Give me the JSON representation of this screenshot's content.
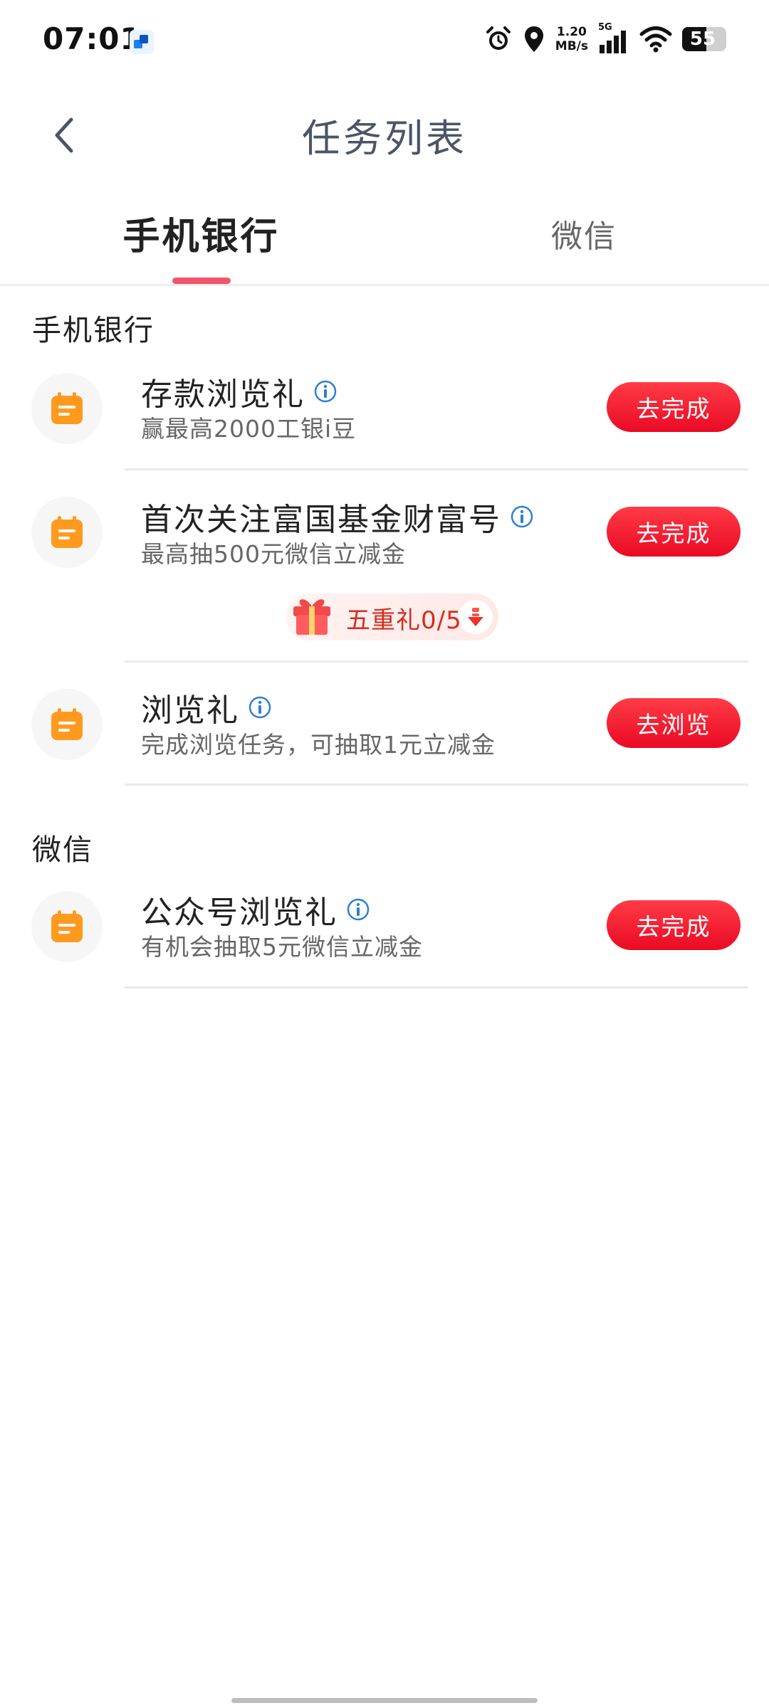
{
  "status_bar": {
    "time": "07:01",
    "net_speed_value": "1.20",
    "net_speed_unit": "MB/s",
    "network_type": "5G",
    "battery": "55",
    "battery_level": 0.55
  },
  "header": {
    "title": "任务列表"
  },
  "tabs": [
    {
      "label": "手机银行",
      "active": true
    },
    {
      "label": "微信",
      "active": false
    }
  ],
  "sections": {
    "mobile_bank": {
      "title": "手机银行",
      "tasks": [
        {
          "title": "存款浏览礼",
          "subtitle": "赢最高2000工银i豆",
          "button": "去完成",
          "icon": "calendar-icon"
        },
        {
          "title": "首次关注富国基金财富号",
          "subtitle": "最高抽500元微信立减金",
          "button": "去完成",
          "icon": "calendar-icon",
          "gift_label": "五重礼0/5"
        },
        {
          "title": "浏览礼",
          "subtitle": "完成浏览任务，可抽取1元立减金",
          "button": "去浏览",
          "icon": "calendar-icon"
        }
      ]
    },
    "wechat": {
      "title": "微信",
      "tasks": [
        {
          "title": "公众号浏览礼",
          "subtitle": "有机会抽取5元微信立减金",
          "button": "去完成",
          "icon": "calendar-icon"
        }
      ]
    }
  },
  "colors": {
    "accent_red": "#ea0a24",
    "tab_indicator": "#f0566a",
    "icon_orange": "#ff9a1f",
    "info_blue": "#2d7fd3"
  }
}
